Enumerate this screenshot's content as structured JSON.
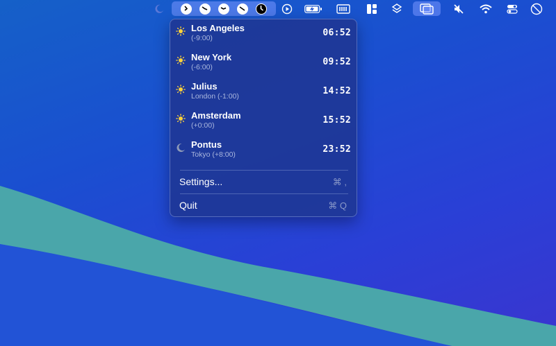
{
  "menubar": {
    "icons": [
      "moon-icon",
      "clock-icon",
      "clock-icon",
      "clock-icon",
      "clock-icon",
      "clock-icon",
      "play-icon",
      "battery-charging-icon",
      "memory-icon",
      "layout-icon",
      "layers-icon",
      "screens-icon",
      "mute-icon",
      "wifi-icon",
      "control-center-icon",
      "compass-icon"
    ]
  },
  "clocks": [
    {
      "city": "Los Angeles",
      "offset": "(-9:00)",
      "time": "06:52",
      "icon": "sun-icon"
    },
    {
      "city": "New York",
      "offset": "(-6:00)",
      "time": "09:52",
      "icon": "sun-icon"
    },
    {
      "city": "Julius",
      "offset": "London (-1:00)",
      "time": "14:52",
      "icon": "sun-icon"
    },
    {
      "city": "Amsterdam",
      "offset": "(+0:00)",
      "time": "15:52",
      "icon": "sun-icon"
    },
    {
      "city": "Pontus",
      "offset": "Tokyo (+8:00)",
      "time": "23:52",
      "icon": "moon-icon"
    }
  ],
  "menu": {
    "settings_label": "Settings...",
    "settings_shortcut": "⌘ ,",
    "quit_label": "Quit",
    "quit_shortcut": "⌘ Q"
  },
  "colors": {
    "accent": "#ffd23a",
    "wave": "#4aa8a8"
  }
}
